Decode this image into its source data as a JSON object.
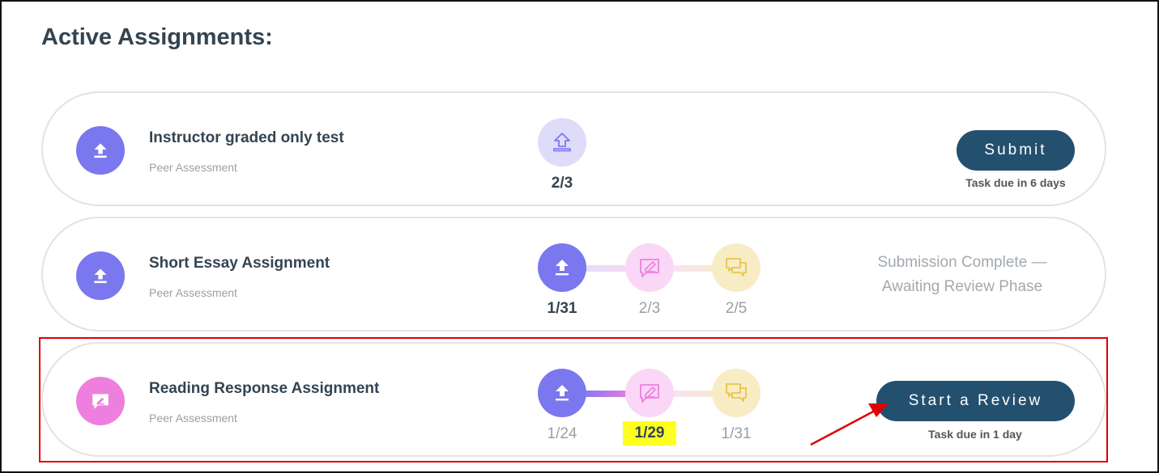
{
  "page": {
    "title": "Active Assignments:"
  },
  "colors": {
    "upload": "#7b77ee",
    "upload_pale": "#dedcf9",
    "review": "#ee7fdf",
    "review_pale": "#fad7f6",
    "feedback_pale": "#f8ecc5",
    "feedback_line": "#e7c54d",
    "button": "#24506f",
    "highlight": "#ffff1e",
    "annotation": "#e00000"
  },
  "assignments": [
    {
      "name": "Instructor graded only test",
      "kind": "Peer Assessment",
      "icon": "upload-icon",
      "stages": [
        {
          "icon": "upload-icon",
          "count": "2/3"
        }
      ],
      "action": {
        "label": "Submit",
        "due": "Task due in 6 days"
      }
    },
    {
      "name": "Short Essay Assignment",
      "kind": "Peer Assessment",
      "icon": "upload-icon",
      "stages": [
        {
          "icon": "upload-icon",
          "count": "1/31"
        },
        {
          "icon": "review-icon",
          "count": "2/3"
        },
        {
          "icon": "feedback-icon",
          "count": "2/5"
        }
      ],
      "status": {
        "line1": "Submission Complete —",
        "line2": "Awaiting Review Phase"
      }
    },
    {
      "name": "Reading Response Assignment",
      "kind": "Peer Assessment",
      "icon": "review-icon",
      "stages": [
        {
          "icon": "upload-icon",
          "count": "1/24"
        },
        {
          "icon": "review-icon",
          "count": "1/29"
        },
        {
          "icon": "feedback-icon",
          "count": "1/31"
        }
      ],
      "action": {
        "label": "Start a Review",
        "due": "Task due in 1 day"
      }
    }
  ]
}
